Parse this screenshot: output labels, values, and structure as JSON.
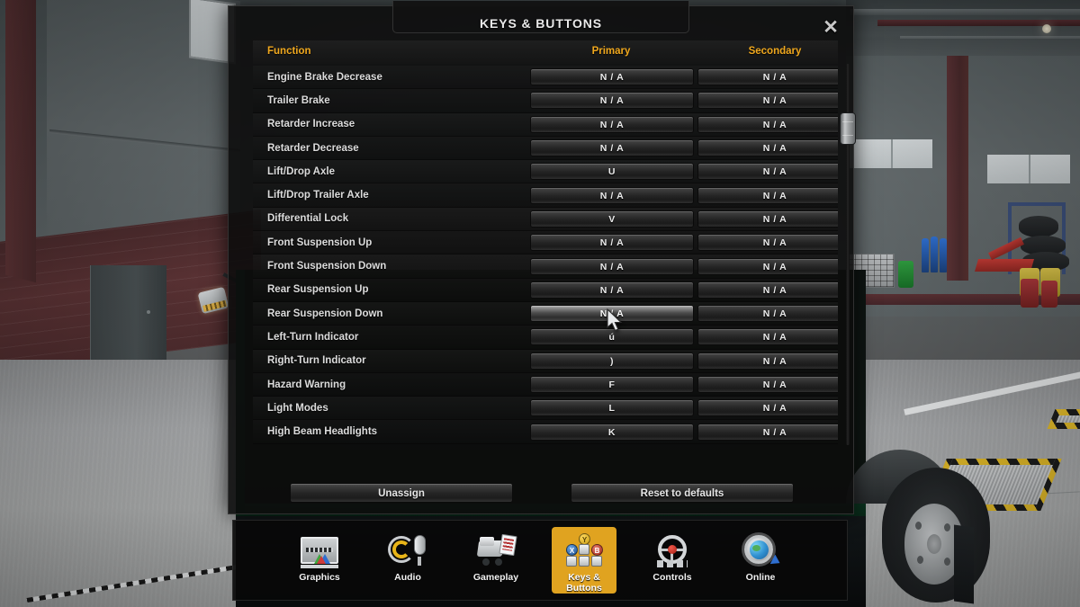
{
  "dialog": {
    "title": "KEYS & BUTTONS",
    "close_label": "✕",
    "close_icon": "close-icon"
  },
  "table": {
    "headers": {
      "function": "Function",
      "primary": "Primary",
      "secondary": "Secondary"
    },
    "rows": [
      {
        "function": "Engine Brake Decrease",
        "primary": "N / A",
        "secondary": "N / A",
        "hover": false
      },
      {
        "function": "Trailer Brake",
        "primary": "N / A",
        "secondary": "N / A",
        "hover": false
      },
      {
        "function": "Retarder Increase",
        "primary": "N / A",
        "secondary": "N / A",
        "hover": false
      },
      {
        "function": "Retarder Decrease",
        "primary": "N / A",
        "secondary": "N / A",
        "hover": false
      },
      {
        "function": "Lift/Drop Axle",
        "primary": "U",
        "secondary": "N / A",
        "hover": false
      },
      {
        "function": "Lift/Drop Trailer Axle",
        "primary": "N / A",
        "secondary": "N / A",
        "hover": false
      },
      {
        "function": "Differential Lock",
        "primary": "V",
        "secondary": "N / A",
        "hover": false
      },
      {
        "function": "Front Suspension Up",
        "primary": "N / A",
        "secondary": "N / A",
        "hover": false
      },
      {
        "function": "Front Suspension Down",
        "primary": "N / A",
        "secondary": "N / A",
        "hover": false
      },
      {
        "function": "Rear Suspension Up",
        "primary": "N / A",
        "secondary": "N / A",
        "hover": false
      },
      {
        "function": "Rear Suspension Down",
        "primary": "N / A",
        "secondary": "N / A",
        "hover": true
      },
      {
        "function": "Left-Turn Indicator",
        "primary": "ú",
        "secondary": "N / A",
        "hover": false
      },
      {
        "function": "Right-Turn Indicator",
        "primary": ")",
        "secondary": "N / A",
        "hover": false
      },
      {
        "function": "Hazard Warning",
        "primary": "F",
        "secondary": "N / A",
        "hover": false
      },
      {
        "function": "Light Modes",
        "primary": "L",
        "secondary": "N / A",
        "hover": false
      },
      {
        "function": "High Beam Headlights",
        "primary": "K",
        "secondary": "N / A",
        "hover": false
      }
    ]
  },
  "actions": {
    "unassign": "Unassign",
    "reset": "Reset to defaults"
  },
  "tabs": [
    {
      "label": "Graphics",
      "icon": "monitor-icon",
      "active": false
    },
    {
      "label": "Audio",
      "icon": "speaker-mic-icon",
      "active": false
    },
    {
      "label": "Gameplay",
      "icon": "truck-document-icon",
      "active": false
    },
    {
      "label": "Keys &\nButtons",
      "icon": "gamepad-keyboard-icon",
      "active": true
    },
    {
      "label": "Controls",
      "icon": "steering-wheel-icon",
      "active": false
    },
    {
      "label": "Online",
      "icon": "globe-gear-icon",
      "active": false
    }
  ],
  "colors": {
    "accent": "#f0a81e",
    "tab_active": "#e0a320",
    "panel_bg": "#0c0c0c",
    "text": "#dcdcdc"
  },
  "scrollbar": {
    "thumb_position_pct": 14
  }
}
